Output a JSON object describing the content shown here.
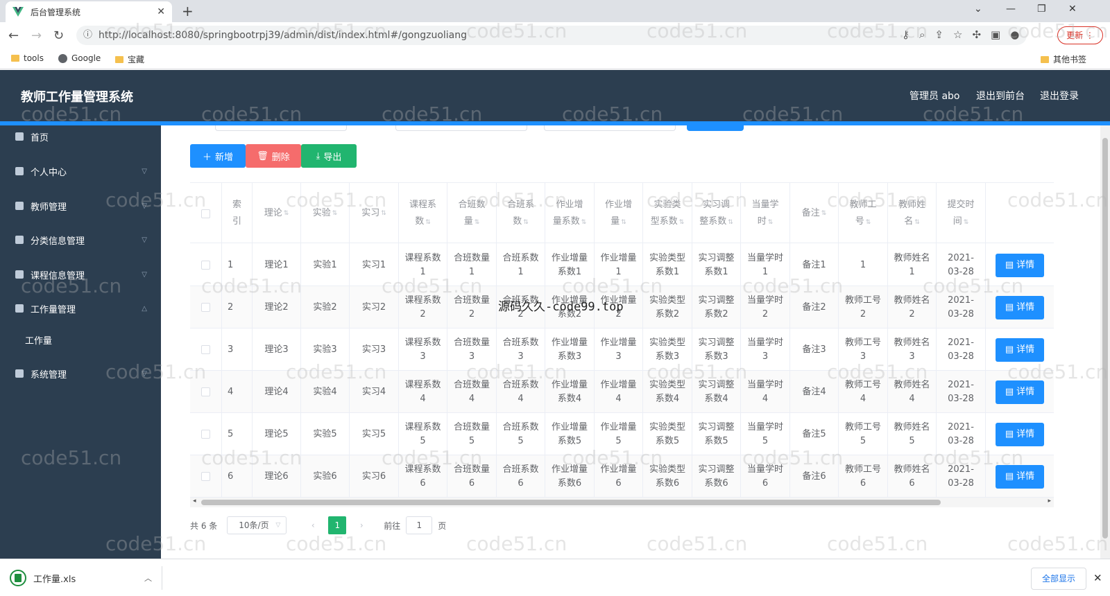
{
  "browser": {
    "tab_title": "后台管理系统",
    "url": "http://localhost:8080/springbootrpj39/admin/dist/index.html#/gongzuoliang",
    "update_label": "更新",
    "bookmarks": [
      "tools",
      "Google",
      "宝藏"
    ],
    "other_bookmarks": "其他书签"
  },
  "header": {
    "title": "教师工作量管理系统",
    "admin_label": "管理员 abo",
    "front_label": "退出到前台",
    "logout_label": "退出登录"
  },
  "sidebar": {
    "items": [
      {
        "label": "首页"
      },
      {
        "label": "个人中心"
      },
      {
        "label": "教师管理"
      },
      {
        "label": "分类信息管理"
      },
      {
        "label": "课程信息管理"
      },
      {
        "label": "工作量管理"
      },
      {
        "label": "工作量"
      },
      {
        "label": "系统管理"
      }
    ]
  },
  "toolbar": {
    "add_label": "新增",
    "delete_label": "删除",
    "export_label": "导出"
  },
  "table": {
    "headers": [
      "索引",
      "理论",
      "实验",
      "实习",
      "课程系数",
      "合班数量",
      "合班系数",
      "作业增量系数",
      "作业增量",
      "实验类型系数",
      "实习调整系数",
      "当量学时",
      "备注",
      "教师工号",
      "教师姓名",
      "提交时间"
    ],
    "detail_label": "详情",
    "rows": [
      [
        "1",
        "理论1",
        "实验1",
        "实习1",
        "课程系数1",
        "合班数量1",
        "合班系数1",
        "作业增量系数1",
        "作业增量1",
        "实验类型系数1",
        "实习调整系数1",
        "当量学时1",
        "备注1",
        "1",
        "教师姓名1",
        "2021-03-28"
      ],
      [
        "2",
        "理论2",
        "实验2",
        "实习2",
        "课程系数2",
        "合班数量2",
        "合班系数2",
        "作业增量系数2",
        "作业增量2",
        "实验类型系数2",
        "实习调整系数2",
        "当量学时2",
        "备注2",
        "教师工号2",
        "教师姓名2",
        "2021-03-28"
      ],
      [
        "3",
        "理论3",
        "实验3",
        "实习3",
        "课程系数3",
        "合班数量3",
        "合班系数3",
        "作业增量系数3",
        "作业增量3",
        "实验类型系数3",
        "实习调整系数3",
        "当量学时3",
        "备注3",
        "教师工号3",
        "教师姓名3",
        "2021-03-28"
      ],
      [
        "4",
        "理论4",
        "实验4",
        "实习4",
        "课程系数4",
        "合班数量4",
        "合班系数4",
        "作业增量系数4",
        "作业增量4",
        "实验类型系数4",
        "实习调整系数4",
        "当量学时4",
        "备注4",
        "教师工号4",
        "教师姓名4",
        "2021-03-28"
      ],
      [
        "5",
        "理论5",
        "实验5",
        "实习5",
        "课程系数5",
        "合班数量5",
        "合班系数5",
        "作业增量系数5",
        "作业增量5",
        "实验类型系数5",
        "实习调整系数5",
        "当量学时5",
        "备注5",
        "教师工号5",
        "教师姓名5",
        "2021-03-28"
      ],
      [
        "6",
        "理论6",
        "实验6",
        "实习6",
        "课程系数6",
        "合班数量6",
        "合班系数6",
        "作业增量系数6",
        "作业增量6",
        "实验类型系数6",
        "实习调整系数6",
        "当量学时6",
        "备注6",
        "教师工号6",
        "教师姓名6",
        "2021-03-28"
      ]
    ]
  },
  "pagination": {
    "total_label": "共 6 条",
    "page_size": "10条/页",
    "current_page": "1",
    "goto_label": "前往",
    "goto_value": "1",
    "page_suffix": "页"
  },
  "download": {
    "filename": "工作量.xls",
    "show_all": "全部显示"
  },
  "watermark": "code51.cn",
  "center_watermark": "源码久久-code99.top",
  "colors": {
    "header_bg": "#2c3e50",
    "accent": "#1e90ff",
    "danger": "#f56c6c",
    "success": "#21b56f"
  }
}
